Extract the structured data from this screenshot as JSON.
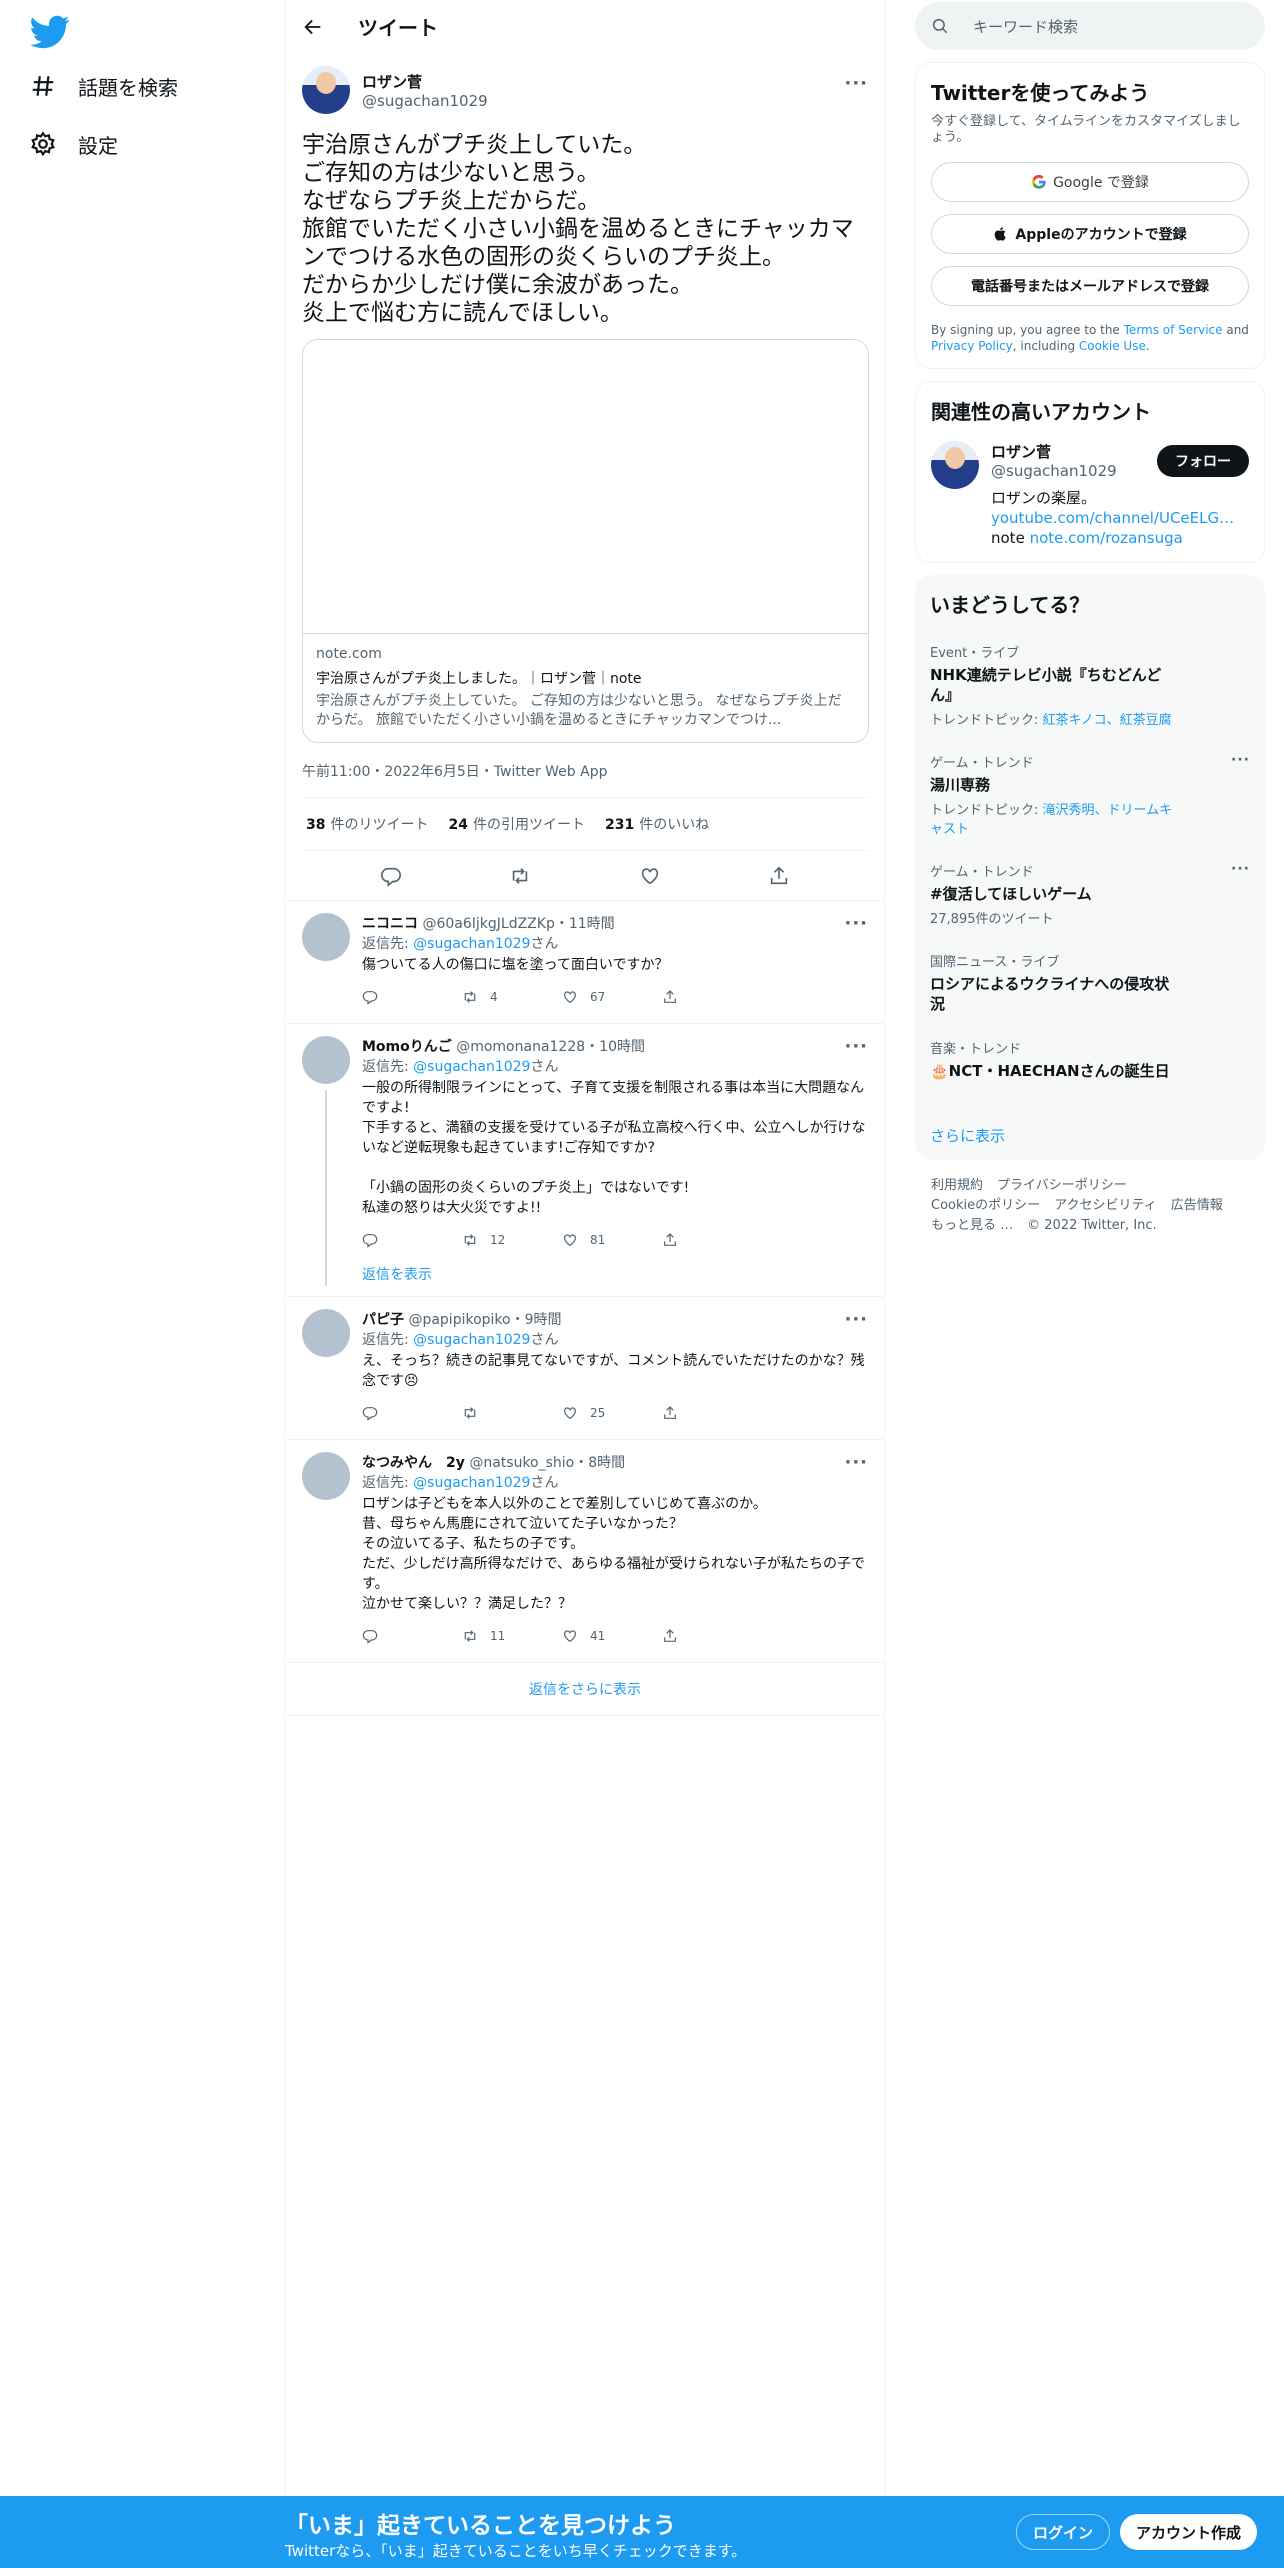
{
  "nav": {
    "explore": "話題を検索",
    "settings": "設定"
  },
  "header": {
    "title": "ツイート"
  },
  "tweet": {
    "display_name": "ロザン菅",
    "handle": "@sugachan1029",
    "text": "宇治原さんがプチ炎上していた。\nご存知の方は少ないと思う。\nなぜならプチ炎上だからだ。\n旅館でいただく小さい小鍋を温めるときにチャッカマンでつける水色の固形の炎くらいのプチ炎上。\nだからか少しだけ僕に余波があった。\n炎上で悩む方に読んでほしい。",
    "card": {
      "domain": "note.com",
      "title": "宇治原さんがプチ炎上しました。｜ロザン菅｜note",
      "desc": "宇治原さんがプチ炎上していた。 ご存知の方は少ないと思う。 なぜならプチ炎上だからだ。 旅館でいただく小さい小鍋を温めるときにチャッカマンでつけ..."
    },
    "meta": "午前11:00・2022年6月5日・Twitter Web App",
    "retweets": "38",
    "retweets_label": "件のリツイート",
    "quotes": "24",
    "quotes_label": "件の引用ツイート",
    "likes": "231",
    "likes_label": "件のいいね"
  },
  "replies": [
    {
      "name": "ニコニコ",
      "handle": "@60a6IjkgJLdZZKp",
      "time": "11時間",
      "reply_prefix": "返信先: ",
      "reply_to": "@sugachan1029",
      "reply_suffix": "さん",
      "text": "傷ついてる人の傷口に塩を塗って面白いですか？",
      "retweets": "4",
      "likes": "67"
    },
    {
      "name": "Momoりんご",
      "handle": "@momonana1228",
      "time": "10時間",
      "reply_prefix": "返信先: ",
      "reply_to": "@sugachan1029",
      "reply_suffix": "さん",
      "text": "一般の所得制限ラインにとって、子育て支援を制限される事は本当に大問題なんですよ!\n下手すると、満額の支援を受けている子が私立高校へ行く中、公立へしか行けないなど逆転現象も起きています!ご存知ですか?\n\n「小鍋の固形の炎くらいのプチ炎上」ではないです!\n私達の怒りは大火災ですよ!!",
      "retweets": "12",
      "likes": "81",
      "show_replies": "返信を表示"
    },
    {
      "name": "パピ子",
      "handle": "@papipikopiko",
      "time": "9時間",
      "reply_prefix": "返信先: ",
      "reply_to": "@sugachan1029",
      "reply_suffix": "さん",
      "text": "え、そっち？続きの記事見てないですが、コメント読んでいただけたのかな？残念です😣",
      "retweets": "",
      "likes": "25"
    },
    {
      "name": "なつみやん　2y",
      "handle": "@natsuko_shio",
      "time": "8時間",
      "reply_prefix": "返信先: ",
      "reply_to": "@sugachan1029",
      "reply_suffix": "さん",
      "text": "ロザンは子どもを本人以外のことで差別していじめて喜ぶのか。\n昔、母ちゃん馬鹿にされて泣いてた子いなかった？\nその泣いてる子、私たちの子です。\nただ、少しだけ高所得なだけで、あらゆる福祉が受けられない子が私たちの子です。\n泣かせて楽しい？？満足した？？",
      "retweets": "11",
      "likes": "41"
    }
  ],
  "more_replies": "返信をさらに表示",
  "search": {
    "placeholder": "キーワード検索"
  },
  "signup": {
    "title": "Twitterを使ってみよう",
    "sub": "今すぐ登録して、タイムラインをカスタマイズしましょう。",
    "google": "Google で登録",
    "apple": "Appleのアカウントで登録",
    "phone": "電話番号またはメールアドレスで登録",
    "terms_1": "By signing up, you agree to the ",
    "terms_link1": "Terms of Service",
    "terms_2": " and ",
    "terms_link2": "Privacy Policy",
    "terms_3": ", including ",
    "terms_link3": "Cookie Use",
    "terms_4": "."
  },
  "related": {
    "title": "関連性の高いアカウント",
    "name": "ロザン菅",
    "handle": "@sugachan1029",
    "follow": "フォロー",
    "bio_text": "ロザンの楽屋。",
    "bio_link": "youtube.com/channel/UCeELG…",
    "bio_note": "note ",
    "bio_note_link": "note.com/rozansuga"
  },
  "trends": {
    "title": "いまどうしてる？",
    "items": [
      {
        "category": "Event・ライブ",
        "name": "NHK連続テレビ小説『ちむどんどん』",
        "meta_prefix": "トレンドトピック: ",
        "meta_links": "紅茶キノコ、紅茶豆腐",
        "dots": ""
      },
      {
        "category": "ゲーム・トレンド",
        "name": "湯川専務",
        "meta_prefix": "トレンドトピック: ",
        "meta_links": "滝沢秀明、ドリームキャスト",
        "dots": "···"
      },
      {
        "category": "ゲーム・トレンド",
        "name": "#復活してほしいゲーム",
        "meta_prefix": "27,895件のツイート",
        "meta_links": "",
        "dots": "···"
      },
      {
        "category": "国際ニュース・ライブ",
        "name": "ロシアによるウクライナへの侵攻状況",
        "meta_prefix": "",
        "meta_links": "",
        "dots": ""
      },
      {
        "category": "音楽・トレンド",
        "name": "🎂NCT・HAECHANさんの誕生日",
        "meta_prefix": "",
        "meta_links": "",
        "dots": ""
      }
    ],
    "show_more": "さらに表示"
  },
  "footer": {
    "terms": "利用規約",
    "privacy": "プライバシーポリシー",
    "cookie": "Cookieのポリシー",
    "accessibility": "アクセシビリティ",
    "ads": "広告情報",
    "more": "もっと見る …",
    "copyright": "© 2022 Twitter, Inc."
  },
  "bottom": {
    "title": "「いま」起きていることを見つけよう",
    "sub": "Twitterなら、「いま」起きていることをいち早くチェックできます。",
    "login": "ログイン",
    "signup": "アカウント作成"
  },
  "colors": {
    "accent": "#1d9bf0",
    "text": "#0f1419",
    "muted": "#536471"
  }
}
